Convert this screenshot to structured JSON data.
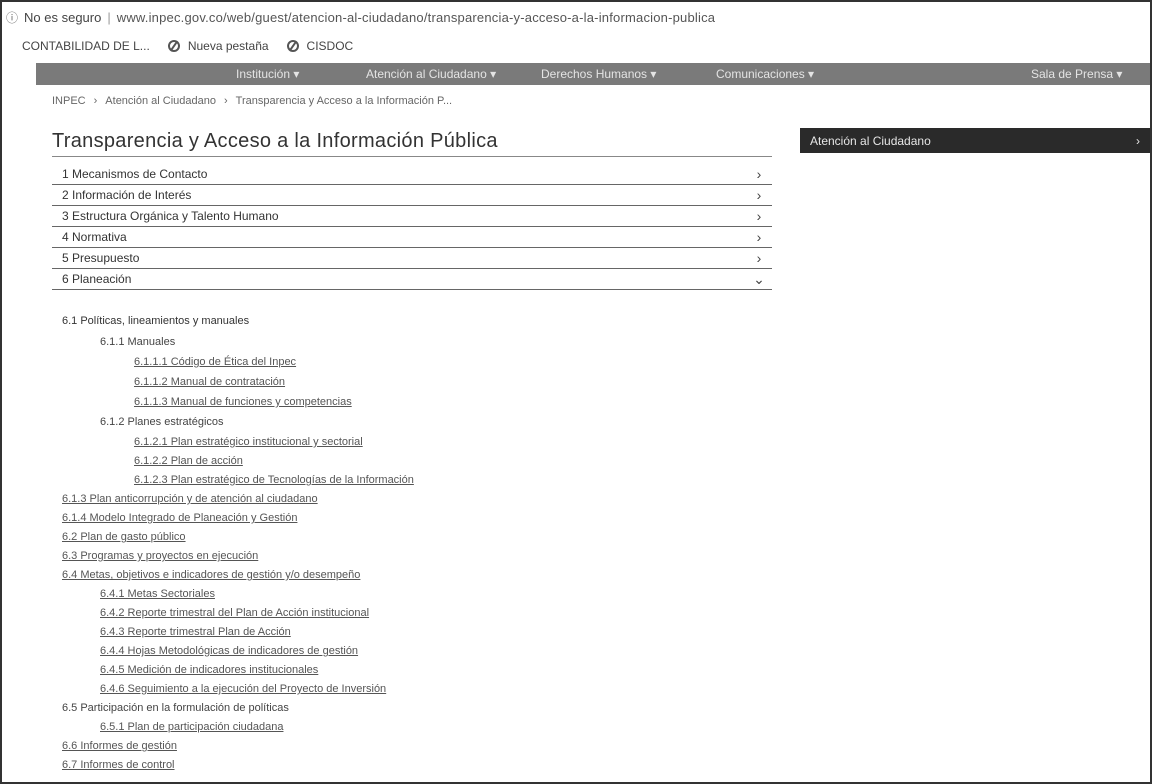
{
  "browser": {
    "security_label": "No es seguro",
    "url": "www.inpec.gov.co/web/guest/atencion-al-ciudadano/transparencia-y-acceso-a-la-informacion-publica"
  },
  "bookmarks": [
    {
      "label": "CONTABILIDAD DE L..."
    },
    {
      "label": "Nueva pestaña",
      "icon": "globe-icon"
    },
    {
      "label": "CISDOC",
      "icon": "globe-icon"
    }
  ],
  "mainnav": [
    {
      "label": "Institución ▾"
    },
    {
      "label": "Atención al Ciudadano ▾"
    },
    {
      "label": "Derechos Humanos ▾"
    },
    {
      "label": "Comunicaciones ▾"
    },
    {
      "label": "Sala de Prensa ▾"
    }
  ],
  "breadcrumb": [
    "INPEC",
    "Atención al Ciudadano",
    "Transparencia y Acceso a la Información P..."
  ],
  "page_title": "Transparencia y Acceso a la Información Pública",
  "sidebar": {
    "label": "Atención al Ciudadano",
    "chevron": "›"
  },
  "accordion": [
    {
      "label": "1 Mecanismos de Contacto",
      "chevron": "›"
    },
    {
      "label": "2 Información de Interés",
      "chevron": "›"
    },
    {
      "label": "3 Estructura Orgánica y Talento Humano",
      "chevron": "›"
    },
    {
      "label": "4 Normativa",
      "chevron": "›"
    },
    {
      "label": "5 Presupuesto",
      "chevron": "›"
    },
    {
      "label": "6 Planeación",
      "chevron": "⌄"
    }
  ],
  "tree": [
    {
      "label": "6.1 Políticas, lineamientos y manuales"
    },
    {
      "label": "6.1.1 Manuales"
    },
    {
      "label": "6.1.1.1 Código de Ética del Inpec"
    },
    {
      "label": "6.1.1.2 Manual de contratación"
    },
    {
      "label": "6.1.1.3 Manual de funciones y competencias"
    },
    {
      "label": "6.1.2 Planes estratégicos"
    },
    {
      "label": "6.1.2.1 Plan estratégico institucional y sectorial"
    },
    {
      "label": "6.1.2.2 Plan de acción"
    },
    {
      "label": "6.1.2.3 Plan estratégico de Tecnologías de la Información"
    },
    {
      "label": "6.1.3 Plan anticorrupción y de atención al ciudadano"
    },
    {
      "label": "6.1.4 Modelo Integrado de Planeación y Gestión"
    },
    {
      "label": "6.2 Plan de gasto público"
    },
    {
      "label": "6.3 Programas y proyectos en ejecución"
    },
    {
      "label": "6.4 Metas, objetivos e indicadores de gestión y/o desempeño"
    },
    {
      "label": "6.4.1 Metas Sectoriales"
    },
    {
      "label": "6.4.2 Reporte trimestral del Plan de Acción institucional"
    },
    {
      "label": "6.4.3 Reporte trimestral Plan de Acción"
    },
    {
      "label": "6.4.4 Hojas Metodológicas de indicadores de gestión"
    },
    {
      "label": "6.4.5 Medición de indicadores institucionales"
    },
    {
      "label": "6.4.6 Seguimiento a la ejecución del Proyecto de Inversión"
    },
    {
      "label": "6.5 Participación en la formulación de políticas"
    },
    {
      "label": "6.5.1 Plan de participación ciudadana"
    },
    {
      "label": "6.6 Informes de gestión"
    },
    {
      "label": "6.7 Informes de control"
    }
  ]
}
